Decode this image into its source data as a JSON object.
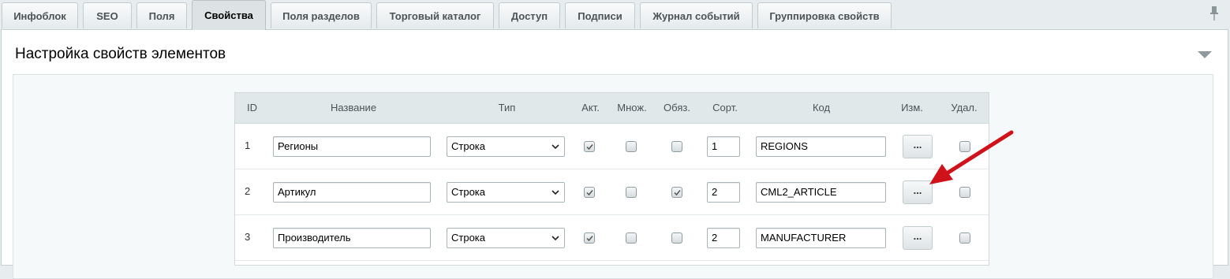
{
  "tabs": [
    {
      "label": "Инфоблок",
      "active": false
    },
    {
      "label": "SEO",
      "active": false
    },
    {
      "label": "Поля",
      "active": false
    },
    {
      "label": "Свойства",
      "active": true
    },
    {
      "label": "Поля разделов",
      "active": false
    },
    {
      "label": "Торговый каталог",
      "active": false
    },
    {
      "label": "Доступ",
      "active": false
    },
    {
      "label": "Подписи",
      "active": false
    },
    {
      "label": "Журнал событий",
      "active": false
    },
    {
      "label": "Группировка свойств",
      "active": false
    }
  ],
  "pin_icon": "pin-icon",
  "panel": {
    "title": "Настройка свойств элементов",
    "collapse_icon": "triangle-down-icon"
  },
  "table": {
    "headers": {
      "id": "ID",
      "name": "Название",
      "type": "Тип",
      "active": "Акт.",
      "multiple": "Множ.",
      "required": "Обяз.",
      "sort": "Сорт.",
      "code": "Код",
      "edit": "Изм.",
      "delete": "Удал."
    },
    "rows": [
      {
        "id": "1",
        "name": "Регионы",
        "type": "Строка",
        "active": true,
        "multiple": false,
        "required": false,
        "sort": "1",
        "code": "REGIONS",
        "edit": "...",
        "delete": false
      },
      {
        "id": "2",
        "name": "Артикул",
        "type": "Строка",
        "active": true,
        "multiple": false,
        "required": true,
        "sort": "2",
        "code": "CML2_ARTICLE",
        "edit": "...",
        "delete": false
      },
      {
        "id": "3",
        "name": "Производитель",
        "type": "Строка",
        "active": true,
        "multiple": false,
        "required": false,
        "sort": "2",
        "code": "MANUFACTURER",
        "edit": "...",
        "delete": false
      }
    ]
  },
  "colors": {
    "arrow": "#d0121b",
    "accent_bg": "#e0e8ea"
  }
}
